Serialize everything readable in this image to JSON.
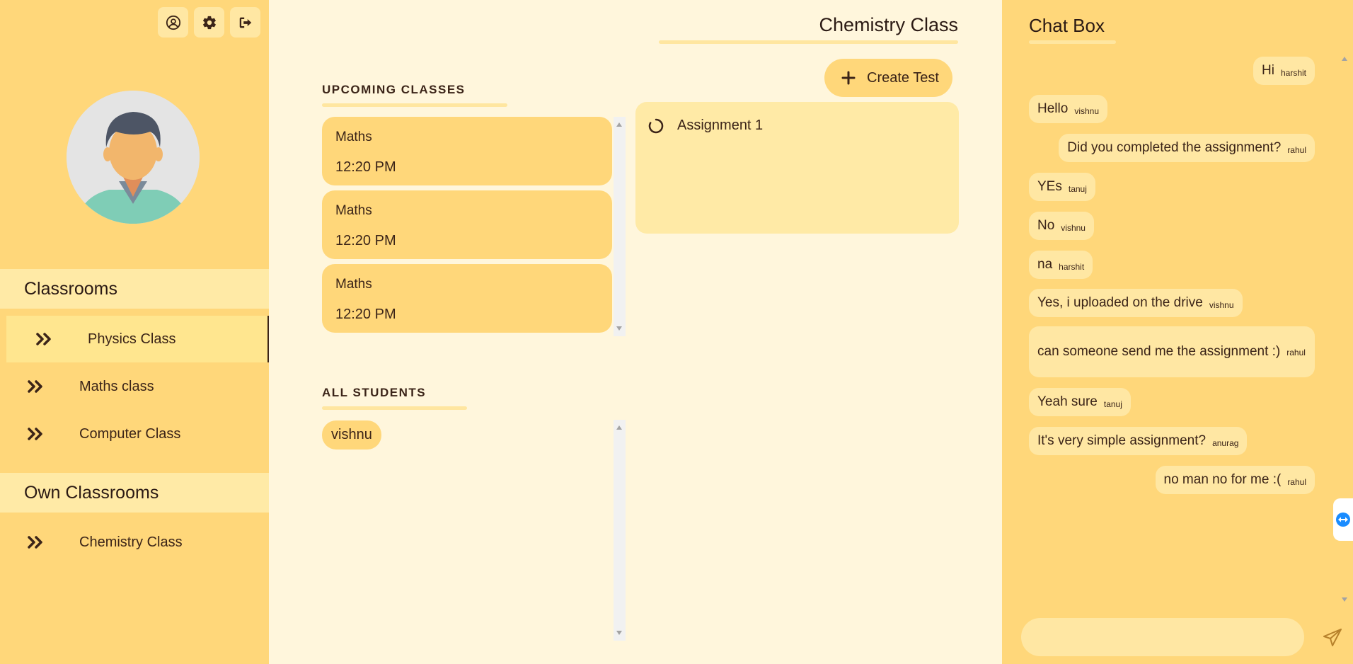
{
  "sidebar": {
    "icons": [
      "profile-icon",
      "gear-icon",
      "logout-icon"
    ],
    "classrooms_header": "Classrooms",
    "classrooms": [
      {
        "label": "Physics Class",
        "active": true
      },
      {
        "label": "Maths class",
        "active": false
      },
      {
        "label": "Computer Class",
        "active": false
      }
    ],
    "own_header": "Own Classrooms",
    "own_classrooms": [
      {
        "label": "Chemistry Class"
      }
    ]
  },
  "main": {
    "title": "Chemistry Class",
    "create_test_label": "Create Test",
    "upcoming_title": "UPCOMING CLASSES",
    "upcoming": [
      {
        "name": "Maths",
        "time": "12:20 PM"
      },
      {
        "name": "Maths",
        "time": "12:20 PM"
      },
      {
        "name": "Maths",
        "time": "12:20 PM"
      }
    ],
    "assignments": [
      {
        "label": "Assignment 1"
      }
    ],
    "students_title": "ALL STUDENTS",
    "students": [
      "vishnu"
    ]
  },
  "chat": {
    "title": "Chat Box",
    "messages": [
      {
        "text": "Hi",
        "user": "harshit",
        "side": "right"
      },
      {
        "text": "Hello",
        "user": "vishnu",
        "side": "left"
      },
      {
        "text": "Did you completed the assignment?",
        "user": "rahul",
        "side": "right"
      },
      {
        "text": "YEs",
        "user": "tanuj",
        "side": "left"
      },
      {
        "text": "No",
        "user": "vishnu",
        "side": "left"
      },
      {
        "text": "na",
        "user": "harshit",
        "side": "left"
      },
      {
        "text": "Yes, i uploaded on the drive",
        "user": "vishnu",
        "side": "left"
      },
      {
        "text": "can someone send me the assignment :)",
        "user": "rahul",
        "side": "left"
      },
      {
        "text": "Yeah sure",
        "user": "tanuj",
        "side": "left"
      },
      {
        "text": "It's very simple assignment?",
        "user": "anurag",
        "side": "left"
      },
      {
        "text": "no man no for me :(",
        "user": "rahul",
        "side": "right"
      }
    ],
    "input_value": "",
    "input_placeholder": ""
  },
  "colors": {
    "sidebar_bg": "#ffd77a",
    "main_bg": "#fff6dc",
    "accent_light": "#ffe7a3",
    "text": "#3b2418"
  }
}
